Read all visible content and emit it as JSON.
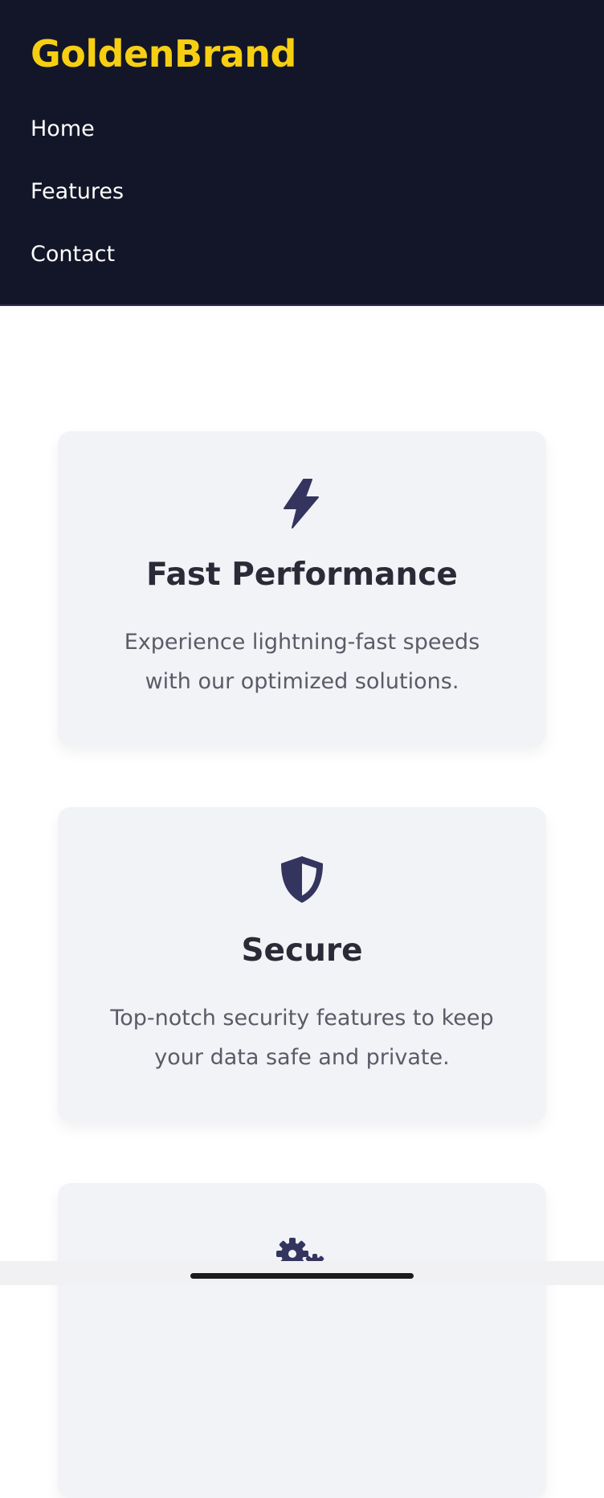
{
  "header": {
    "brand": "GoldenBrand",
    "nav": [
      {
        "label": "Home"
      },
      {
        "label": "Features"
      },
      {
        "label": "Contact"
      }
    ]
  },
  "features": [
    {
      "icon": "lightning-bolt-icon",
      "title": "Fast Performance",
      "description": "Experience lightning-fast speeds with our optimized solutions."
    },
    {
      "icon": "shield-icon",
      "title": "Secure",
      "description": "Top-notch security features to keep your data safe and private."
    },
    {
      "icon": "gears-icon",
      "title": "",
      "description": ""
    }
  ],
  "colors": {
    "header_bg": "#131628",
    "brand": "#f7cf12",
    "icon": "#34355f",
    "card_bg": "#f2f3f7",
    "title": "#2b2b38",
    "text": "#5a5b66"
  }
}
